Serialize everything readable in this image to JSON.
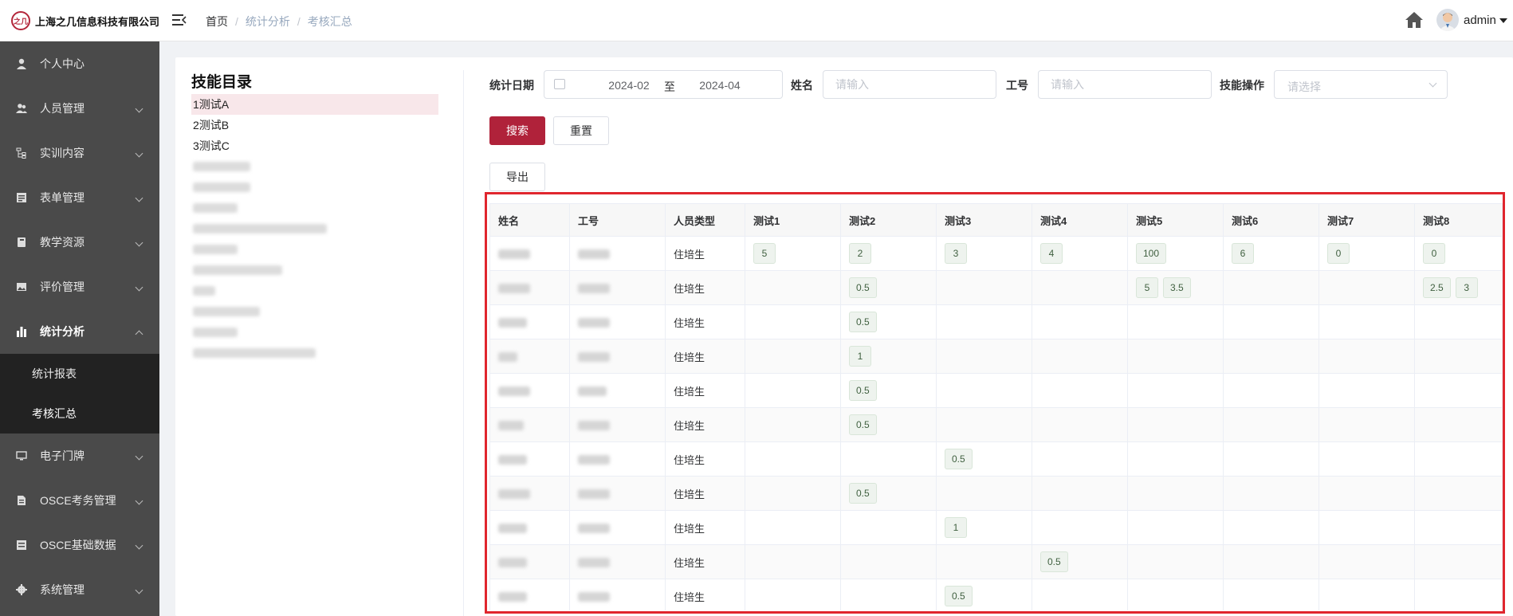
{
  "header": {
    "logo_mark": "之几",
    "company": "上海之几信息科技有限公司",
    "breadcrumb": [
      "首页",
      "统计分析",
      "考核汇总"
    ],
    "breadcrumb_sep": "/",
    "user": "admin"
  },
  "sidebar": {
    "items": [
      {
        "label": "个人中心",
        "icon": "user-icon",
        "expandable": false
      },
      {
        "label": "人员管理",
        "icon": "users-icon",
        "expandable": true
      },
      {
        "label": "实训内容",
        "icon": "tree-icon",
        "expandable": true
      },
      {
        "label": "表单管理",
        "icon": "form-icon",
        "expandable": true
      },
      {
        "label": "教学资源",
        "icon": "book-icon",
        "expandable": true
      },
      {
        "label": "评价管理",
        "icon": "image-icon",
        "expandable": true
      },
      {
        "label": "统计分析",
        "icon": "bar-chart-icon",
        "expandable": true,
        "open": true
      },
      {
        "label": "电子门牌",
        "icon": "monitor-icon",
        "expandable": true
      },
      {
        "label": "OSCE考务管理",
        "icon": "document-icon",
        "expandable": true
      },
      {
        "label": "OSCE基础数据",
        "icon": "database-icon",
        "expandable": true
      },
      {
        "label": "系统管理",
        "icon": "gear-icon",
        "expandable": true
      }
    ],
    "sub_items": [
      "统计报表",
      "考核汇总"
    ]
  },
  "tree": {
    "title": "技能目录",
    "items": [
      "1测试A",
      "2测试B",
      "3测试C"
    ]
  },
  "filters": {
    "date_label": "统计日期",
    "date_start": "2024-02",
    "date_to": "至",
    "date_end": "2024-04",
    "name_label": "姓名",
    "name_placeholder": "请输入",
    "id_label": "工号",
    "id_placeholder": "请输入",
    "skill_label": "技能操作",
    "skill_placeholder": "请选择"
  },
  "buttons": {
    "search": "搜索",
    "reset": "重置",
    "export": "导出"
  },
  "table": {
    "columns": [
      "姓名",
      "工号",
      "人员类型",
      "测试1",
      "测试2",
      "测试3",
      "测试4",
      "测试5",
      "测试6",
      "测试7",
      "测试8"
    ],
    "rows": [
      {
        "type": "住培生",
        "scores": [
          [
            "5"
          ],
          [
            "2"
          ],
          [
            "3"
          ],
          [
            "4"
          ],
          [
            "100"
          ],
          [
            "6"
          ],
          [
            "0"
          ],
          [
            "0"
          ]
        ]
      },
      {
        "type": "住培生",
        "scores": [
          [],
          [
            "0.5"
          ],
          [],
          [],
          [
            "5",
            "3.5"
          ],
          [],
          [],
          [
            "2.5",
            "3"
          ]
        ]
      },
      {
        "type": "住培生",
        "scores": [
          [],
          [
            "0.5"
          ],
          [],
          [],
          [],
          [],
          [],
          []
        ]
      },
      {
        "type": "住培生",
        "scores": [
          [],
          [
            "1"
          ],
          [],
          [],
          [],
          [],
          [],
          []
        ]
      },
      {
        "type": "住培生",
        "scores": [
          [],
          [
            "0.5"
          ],
          [],
          [],
          [],
          [],
          [],
          []
        ]
      },
      {
        "type": "住培生",
        "scores": [
          [],
          [
            "0.5"
          ],
          [],
          [],
          [],
          [],
          [],
          []
        ]
      },
      {
        "type": "住培生",
        "scores": [
          [],
          [],
          [
            "0.5"
          ],
          [],
          [],
          [],
          [],
          []
        ]
      },
      {
        "type": "住培生",
        "scores": [
          [],
          [
            "0.5"
          ],
          [],
          [],
          [],
          [],
          [],
          []
        ]
      },
      {
        "type": "住培生",
        "scores": [
          [],
          [],
          [
            "1"
          ],
          [],
          [],
          [],
          [],
          []
        ]
      },
      {
        "type": "住培生",
        "scores": [
          [],
          [],
          [],
          [
            "0.5"
          ],
          [],
          [],
          [],
          []
        ]
      },
      {
        "type": "住培生",
        "scores": [
          [],
          [],
          [
            "0.5"
          ],
          [],
          [],
          [],
          [],
          []
        ]
      }
    ]
  },
  "colors": {
    "brand": "#b0223a",
    "sidebar_bg": "#4a4a4a",
    "submenu_bg": "#222222",
    "highlight": "#e0262e"
  }
}
